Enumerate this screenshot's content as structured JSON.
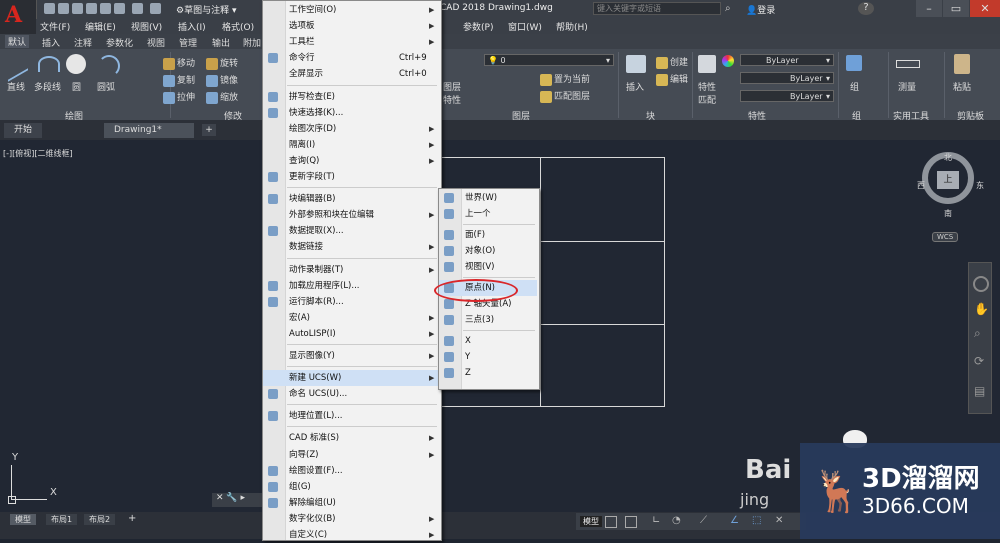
{
  "title_bar": {
    "workspace": "草图与注释",
    "document_title": "CAD 2018     Drawing1.dwg",
    "search_placeholder": "键入关键字或短语",
    "login": "登录",
    "help": "?"
  },
  "menubar": [
    {
      "label": "文件(F)"
    },
    {
      "label": "编辑(E)"
    },
    {
      "label": "视图(V)"
    },
    {
      "label": "插入(I)"
    },
    {
      "label": "格式(O)"
    },
    {
      "label": "参数(P)"
    },
    {
      "label": "窗口(W)"
    },
    {
      "label": "帮助(H)"
    }
  ],
  "ribbon_tabs": [
    {
      "label": "默认"
    },
    {
      "label": "插入"
    },
    {
      "label": "注释"
    },
    {
      "label": "参数化"
    },
    {
      "label": "视图"
    },
    {
      "label": "管理"
    },
    {
      "label": "输出"
    },
    {
      "label": "附加"
    }
  ],
  "ribbon": {
    "draw": {
      "line": "直线",
      "polyline": "多段线",
      "circle": "圆",
      "arc": "圆弧",
      "title": "绘图"
    },
    "modify": {
      "move": "移动",
      "rotate": "旋转",
      "copy": "复制",
      "mirror": "镜像",
      "stretch": "拉伸",
      "scale": "缩放",
      "title": "修改"
    },
    "layers": {
      "layer_value": "0",
      "make_current": "置为当前",
      "match_layer": "匹配图层",
      "layer_props_line1": "图层",
      "layer_props_line2": "特性",
      "title": "图层"
    },
    "block": {
      "insert": "插入",
      "create": "创建",
      "edit": "编辑",
      "title": "块"
    },
    "properties": {
      "match_line1": "特性",
      "match_line2": "匹配",
      "color": "ByLayer",
      "linetype": "ByLayer",
      "lineweight": "ByLayer",
      "title": "特性"
    },
    "groups": {
      "group": "组",
      "title": "组"
    },
    "utilities": {
      "measure": "测量",
      "title": "实用工具"
    },
    "clipboard": {
      "paste": "粘贴",
      "title": "剪贴板"
    }
  },
  "file_tabs": [
    {
      "label": "开始"
    },
    {
      "label": "Drawing1*"
    }
  ],
  "viewport_label": "[-][俯视][二维线框]",
  "viewcube": {
    "north": "北",
    "south": "南",
    "east": "东",
    "west": "西",
    "face": "上",
    "wcs": "WCS"
  },
  "ucs_icon": {
    "x": "X",
    "y": "Y"
  },
  "layout_tabs": [
    {
      "label": "模型"
    },
    {
      "label": "布局1"
    },
    {
      "label": "布局2"
    }
  ],
  "status": {
    "model": "模型"
  },
  "tools_menu": [
    {
      "label": "工作空间(O)",
      "arrow": true
    },
    {
      "label": "选项板",
      "arrow": true
    },
    {
      "label": "工具栏",
      "arrow": true
    },
    {
      "label": "命令行",
      "shortcut": "Ctrl+9",
      "icon": "command-line-icon"
    },
    {
      "label": "全屏显示",
      "shortcut": "Ctrl+0"
    },
    {
      "sep": true
    },
    {
      "label": "拼写检查(E)",
      "icon": "spell-check-icon"
    },
    {
      "label": "快速选择(K)...",
      "icon": "quick-select-icon"
    },
    {
      "label": "绘图次序(D)",
      "arrow": true
    },
    {
      "label": "隔离(I)",
      "arrow": true
    },
    {
      "label": "查询(Q)",
      "arrow": true
    },
    {
      "label": "更新字段(T)",
      "icon": "update-field-icon"
    },
    {
      "sep": true
    },
    {
      "label": "块编辑器(B)",
      "icon": "block-editor-icon"
    },
    {
      "label": "外部参照和块在位编辑",
      "arrow": true
    },
    {
      "label": "数据提取(X)...",
      "icon": "data-extraction-icon"
    },
    {
      "label": "数据链接",
      "arrow": true
    },
    {
      "sep": true
    },
    {
      "label": "动作录制器(T)",
      "arrow": true
    },
    {
      "label": "加载应用程序(L)...",
      "icon": "load-app-icon"
    },
    {
      "label": "运行脚本(R)...",
      "icon": "run-script-icon"
    },
    {
      "label": "宏(A)",
      "arrow": true
    },
    {
      "label": "AutoLISP(I)",
      "arrow": true
    },
    {
      "sep": true
    },
    {
      "label": "显示图像(Y)",
      "arrow": true
    },
    {
      "sep": true
    },
    {
      "label": "新建 UCS(W)",
      "arrow": true,
      "active": true
    },
    {
      "label": "命名 UCS(U)...",
      "icon": "named-ucs-icon"
    },
    {
      "sep": true
    },
    {
      "label": "地理位置(L)...",
      "icon": "geolocation-icon"
    },
    {
      "sep": true
    },
    {
      "label": "CAD 标准(S)",
      "arrow": true
    },
    {
      "label": "向导(Z)",
      "arrow": true
    },
    {
      "label": "绘图设置(F)...",
      "icon": "drafting-settings-icon"
    },
    {
      "label": "组(G)",
      "icon": "group-icon"
    },
    {
      "label": "解除编组(U)",
      "icon": "ungroup-icon"
    },
    {
      "label": "数字化仪(B)",
      "arrow": true
    },
    {
      "label": "自定义(C)",
      "arrow": true
    }
  ],
  "ucs_submenu": [
    {
      "label": "世界(W)",
      "icon": "ucs-world-icon"
    },
    {
      "label": "上一个",
      "icon": "ucs-previous-icon"
    },
    {
      "sep": true
    },
    {
      "label": "面(F)",
      "icon": "ucs-face-icon"
    },
    {
      "label": "对象(O)",
      "icon": "ucs-object-icon"
    },
    {
      "label": "视图(V)",
      "icon": "ucs-view-icon"
    },
    {
      "sep": true
    },
    {
      "label": "原点(N)",
      "icon": "ucs-origin-icon",
      "highlighted": true
    },
    {
      "label": "Z 轴矢量(A)",
      "icon": "ucs-zaxis-icon"
    },
    {
      "label": "三点(3)",
      "icon": "ucs-3point-icon"
    },
    {
      "sep": true
    },
    {
      "label": "X",
      "icon": "ucs-x-icon"
    },
    {
      "label": "Y",
      "icon": "ucs-y-icon"
    },
    {
      "label": "Z",
      "icon": "ucs-z-icon"
    }
  ],
  "watermark": {
    "brand": "3D溜溜网",
    "site": "3D66.COM",
    "baidu": "Bai",
    "baidu_sub": "jing"
  }
}
